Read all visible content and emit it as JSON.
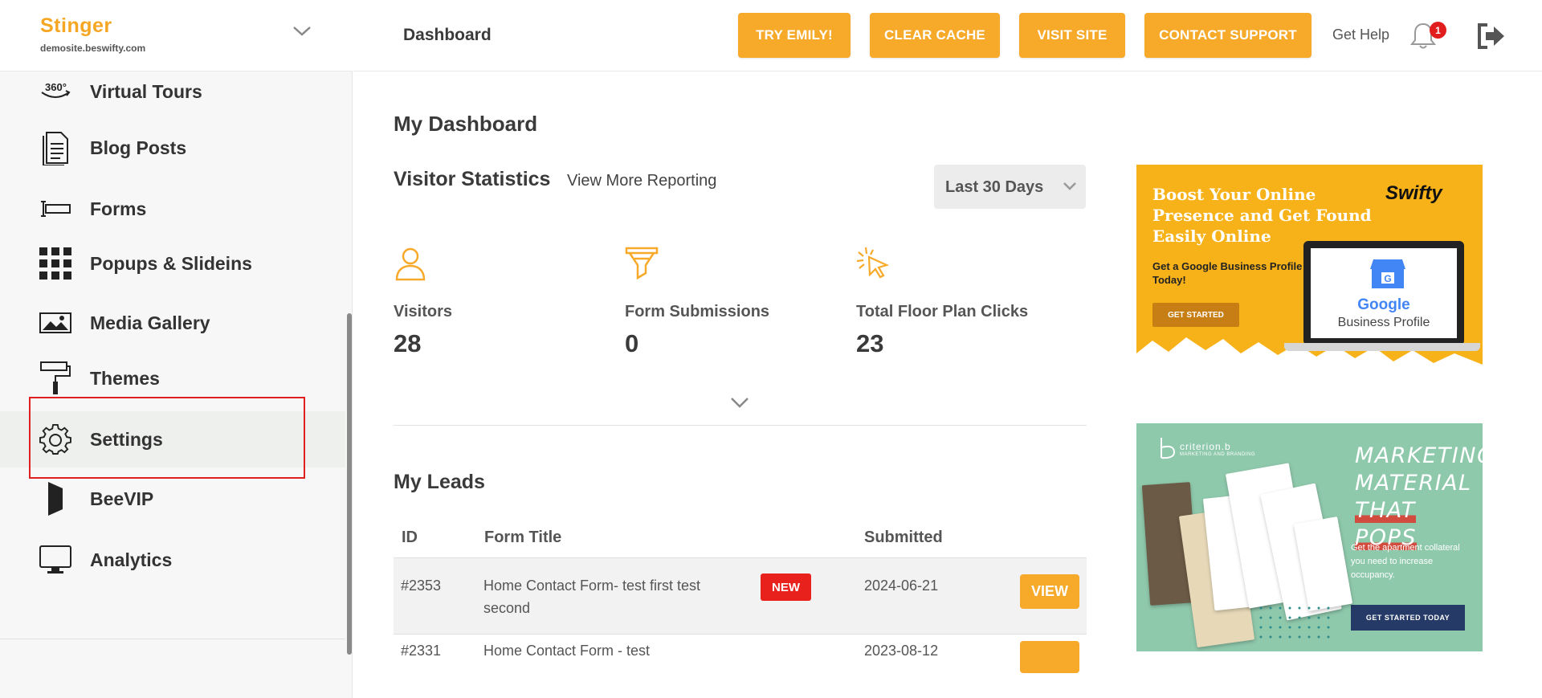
{
  "sidebar": {
    "brand": "Stinger",
    "domain": "demosite.beswifty.com",
    "items": [
      {
        "label": "Virtual Tours",
        "icon": "360-icon"
      },
      {
        "label": "Blog Posts",
        "icon": "document-icon"
      },
      {
        "label": "Forms",
        "icon": "form-field-icon"
      },
      {
        "label": "Popups & Slideins",
        "icon": "grid-icon"
      },
      {
        "label": "Media Gallery",
        "icon": "image-icon"
      },
      {
        "label": "Themes",
        "icon": "paint-roller-icon"
      },
      {
        "label": "Settings",
        "icon": "gear-icon"
      },
      {
        "label": "BeeVIP",
        "icon": "bookmark-shape-icon"
      },
      {
        "label": "Analytics",
        "icon": "monitor-icon"
      }
    ]
  },
  "topbar": {
    "title": "Dashboard",
    "buttons": [
      "TRY EMILY!",
      "CLEAR CACHE",
      "VISIT SITE",
      "CONTACT SUPPORT"
    ],
    "help": "Get Help",
    "notification_count": "1"
  },
  "main": {
    "heading": "My Dashboard",
    "visitor_stats": {
      "heading": "Visitor Statistics",
      "more_link": "View More Reporting",
      "range": "Last 30 Days",
      "stats": [
        {
          "label": "Visitors",
          "value": "28",
          "icon": "person-icon"
        },
        {
          "label": "Form Submissions",
          "value": "0",
          "icon": "funnel-icon"
        },
        {
          "label": "Total Floor Plan Clicks",
          "value": "23",
          "icon": "click-cursor-icon"
        }
      ]
    },
    "leads": {
      "heading": "My Leads",
      "columns": [
        "ID",
        "Form Title",
        "Submitted"
      ],
      "rows": [
        {
          "id": "#2353",
          "title_line1": "Home Contact Form- test first test",
          "title_line2": "second",
          "badge": "NEW",
          "submitted": "2024-06-21",
          "action": "VIEW"
        },
        {
          "id": "#2331",
          "title_line1": "Home Contact Form - test",
          "title_line2": "",
          "badge": "",
          "submitted": "2023-08-12",
          "action": ""
        }
      ]
    }
  },
  "ads": {
    "ad1": {
      "headline": "Boost Your Online Presence and Get Found Easily Online",
      "sub": "Get a Google Business Profile Today!",
      "cta": "GET STARTED",
      "logo": "Swifty",
      "google": "Google",
      "business_profile": "Business Profile",
      "color": "#f7b21a"
    },
    "ad2": {
      "brand": "criterion.b",
      "brand_sub": "MARKETING AND BRANDING",
      "headline_line1": "MARKETING",
      "headline_line2": "MATERIAL",
      "headline_line3": "THAT POPS",
      "body": "Get the apartment collateral you need to increase occupancy.",
      "cta": "GET STARTED TODAY",
      "color": "#8fc9ac"
    }
  },
  "colors": {
    "accent": "#f7a92a",
    "badge_red": "#e21d1d",
    "highlight": "#e0201f"
  }
}
